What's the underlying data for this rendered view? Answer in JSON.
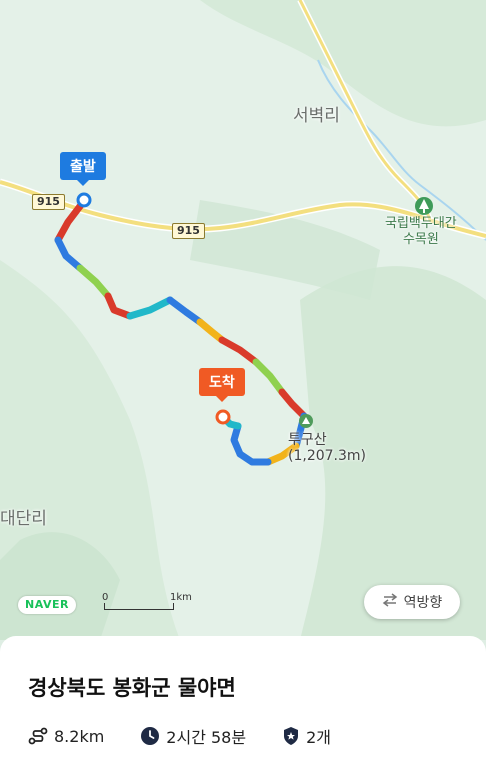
{
  "map": {
    "place_labels": {
      "seobyeok": "서벽리",
      "arboretum_line1": "국립백두대간",
      "arboretum_line2": "수목원",
      "mountain_name": "투구산",
      "mountain_height": "(1,207.3m)",
      "daedan": "대단리"
    },
    "road_numbers": [
      "915",
      "915"
    ],
    "start_label": "출발",
    "end_label": "도착",
    "naver_logo": "NAVER",
    "scale": {
      "zero": "0",
      "distance": "1km"
    },
    "reverse_button": {
      "label": "역방향",
      "icon": "swap-arrows-icon"
    },
    "colors": {
      "start": "#1e7be0",
      "end": "#f05a24",
      "route_segments": [
        "#d93a2b",
        "#2f7be0",
        "#f2b31a",
        "#8fd14f",
        "#21b8c9"
      ]
    }
  },
  "course": {
    "title": "경상북도 봉화군 물야면",
    "distance": "8.2km",
    "duration": "2시간 58분",
    "badge_count": "2개",
    "icons": [
      "route-icon",
      "clock-icon",
      "shield-badge-icon"
    ]
  }
}
